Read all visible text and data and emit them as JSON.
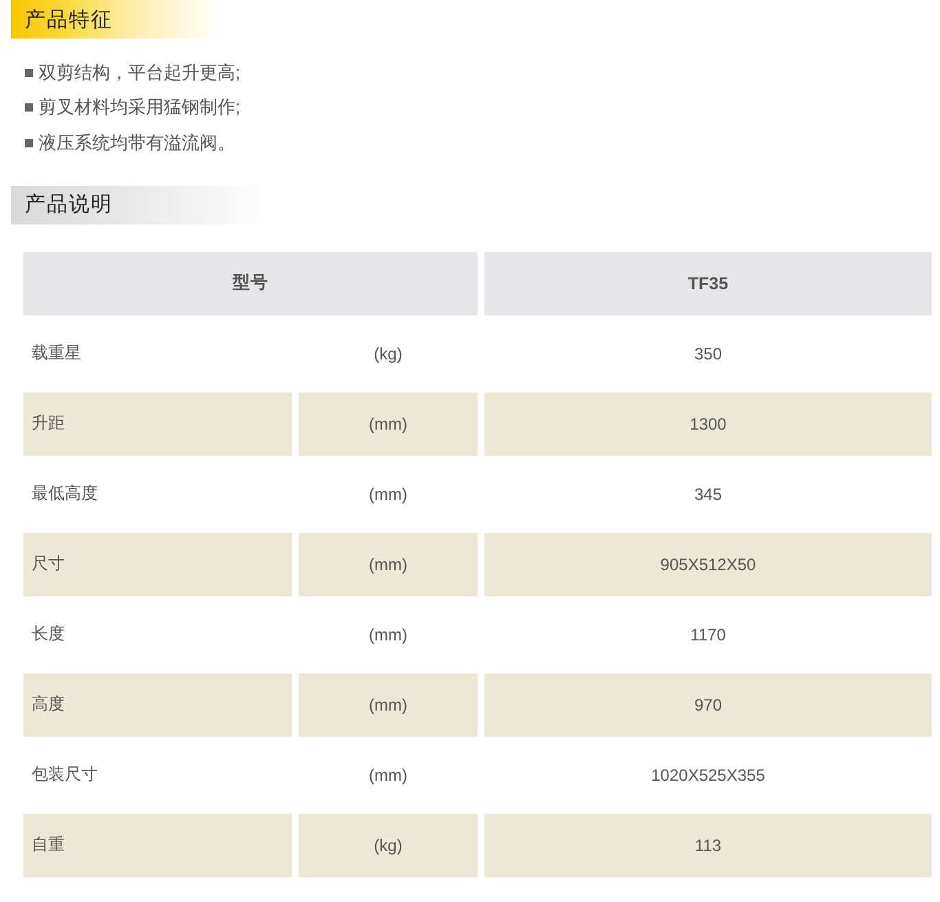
{
  "features": {
    "heading": {
      "kind": "highlight",
      "text": "产品特征"
    },
    "items": [
      "双剪结构，平台起升更高;",
      "剪叉材料均采用猛钢制作;",
      "液压系统均带有溢流阀。"
    ]
  },
  "description": {
    "heading": {
      "kind": "plain",
      "text": "产品说明"
    },
    "table": {
      "columns": [
        "型号",
        "TF35"
      ],
      "rows": [
        {
          "name": "载重星",
          "unit": "(kg)",
          "value": "350"
        },
        {
          "name": "升距",
          "unit": "(mm)",
          "value": "1300"
        },
        {
          "name": "最低高度",
          "unit": "(mm)",
          "value": "345"
        },
        {
          "name": "尺寸",
          "unit": "(mm)",
          "value": "905X512X50"
        },
        {
          "name": "长度",
          "unit": "(mm)",
          "value": "1170"
        },
        {
          "name": "高度",
          "unit": "(mm)",
          "value": "970"
        },
        {
          "name": "包装尺寸",
          "unit": "(mm)",
          "value": "1020X525X355"
        },
        {
          "name": "自重",
          "unit": "(kg)",
          "value": "113"
        }
      ]
    }
  }
}
